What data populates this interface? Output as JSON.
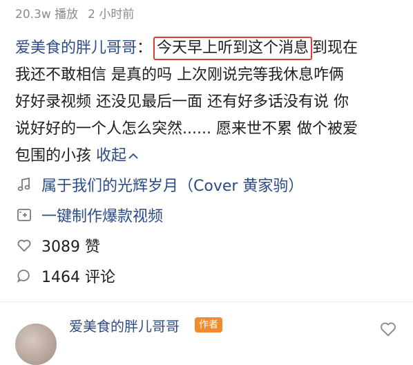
{
  "meta": {
    "plays": "20.3w 播放",
    "time": "2 小时前"
  },
  "caption": {
    "author": "爱美食的胖儿哥哥",
    "colon": "：",
    "highlight": "今天早上听到这个消息",
    "line1_rest": "到现在",
    "line2": "我还不敢相信 是真的吗 上次刚说完等我休息咋俩",
    "line3": "好好录视频 还没见最后一面  还有好多话没有说 你",
    "line4": "说好好的一个人怎么突然...... 愿来世不累 做个被爱",
    "line5": "包围的小孩",
    "collapse": "收起",
    "collapse_icon": "chevron-up-icon"
  },
  "music": {
    "icon": "music-note-icon",
    "label": "属于我们的光辉岁月（Cover 黄家驹）"
  },
  "make_video": {
    "icon": "video-create-icon",
    "label": "一键制作爆款视频"
  },
  "likes": {
    "icon": "heart-icon",
    "label": "3089 赞"
  },
  "comments": {
    "icon": "comment-icon",
    "label": "1464 评论"
  },
  "first_comment": {
    "author": "爱美食的胖儿哥哥",
    "badge": "作者",
    "like_icon": "heart-icon"
  },
  "colors": {
    "link": "#2b4a86",
    "highlight_border": "#e53935",
    "badge": "#f28a2e",
    "meta": "#8a8a8a"
  }
}
